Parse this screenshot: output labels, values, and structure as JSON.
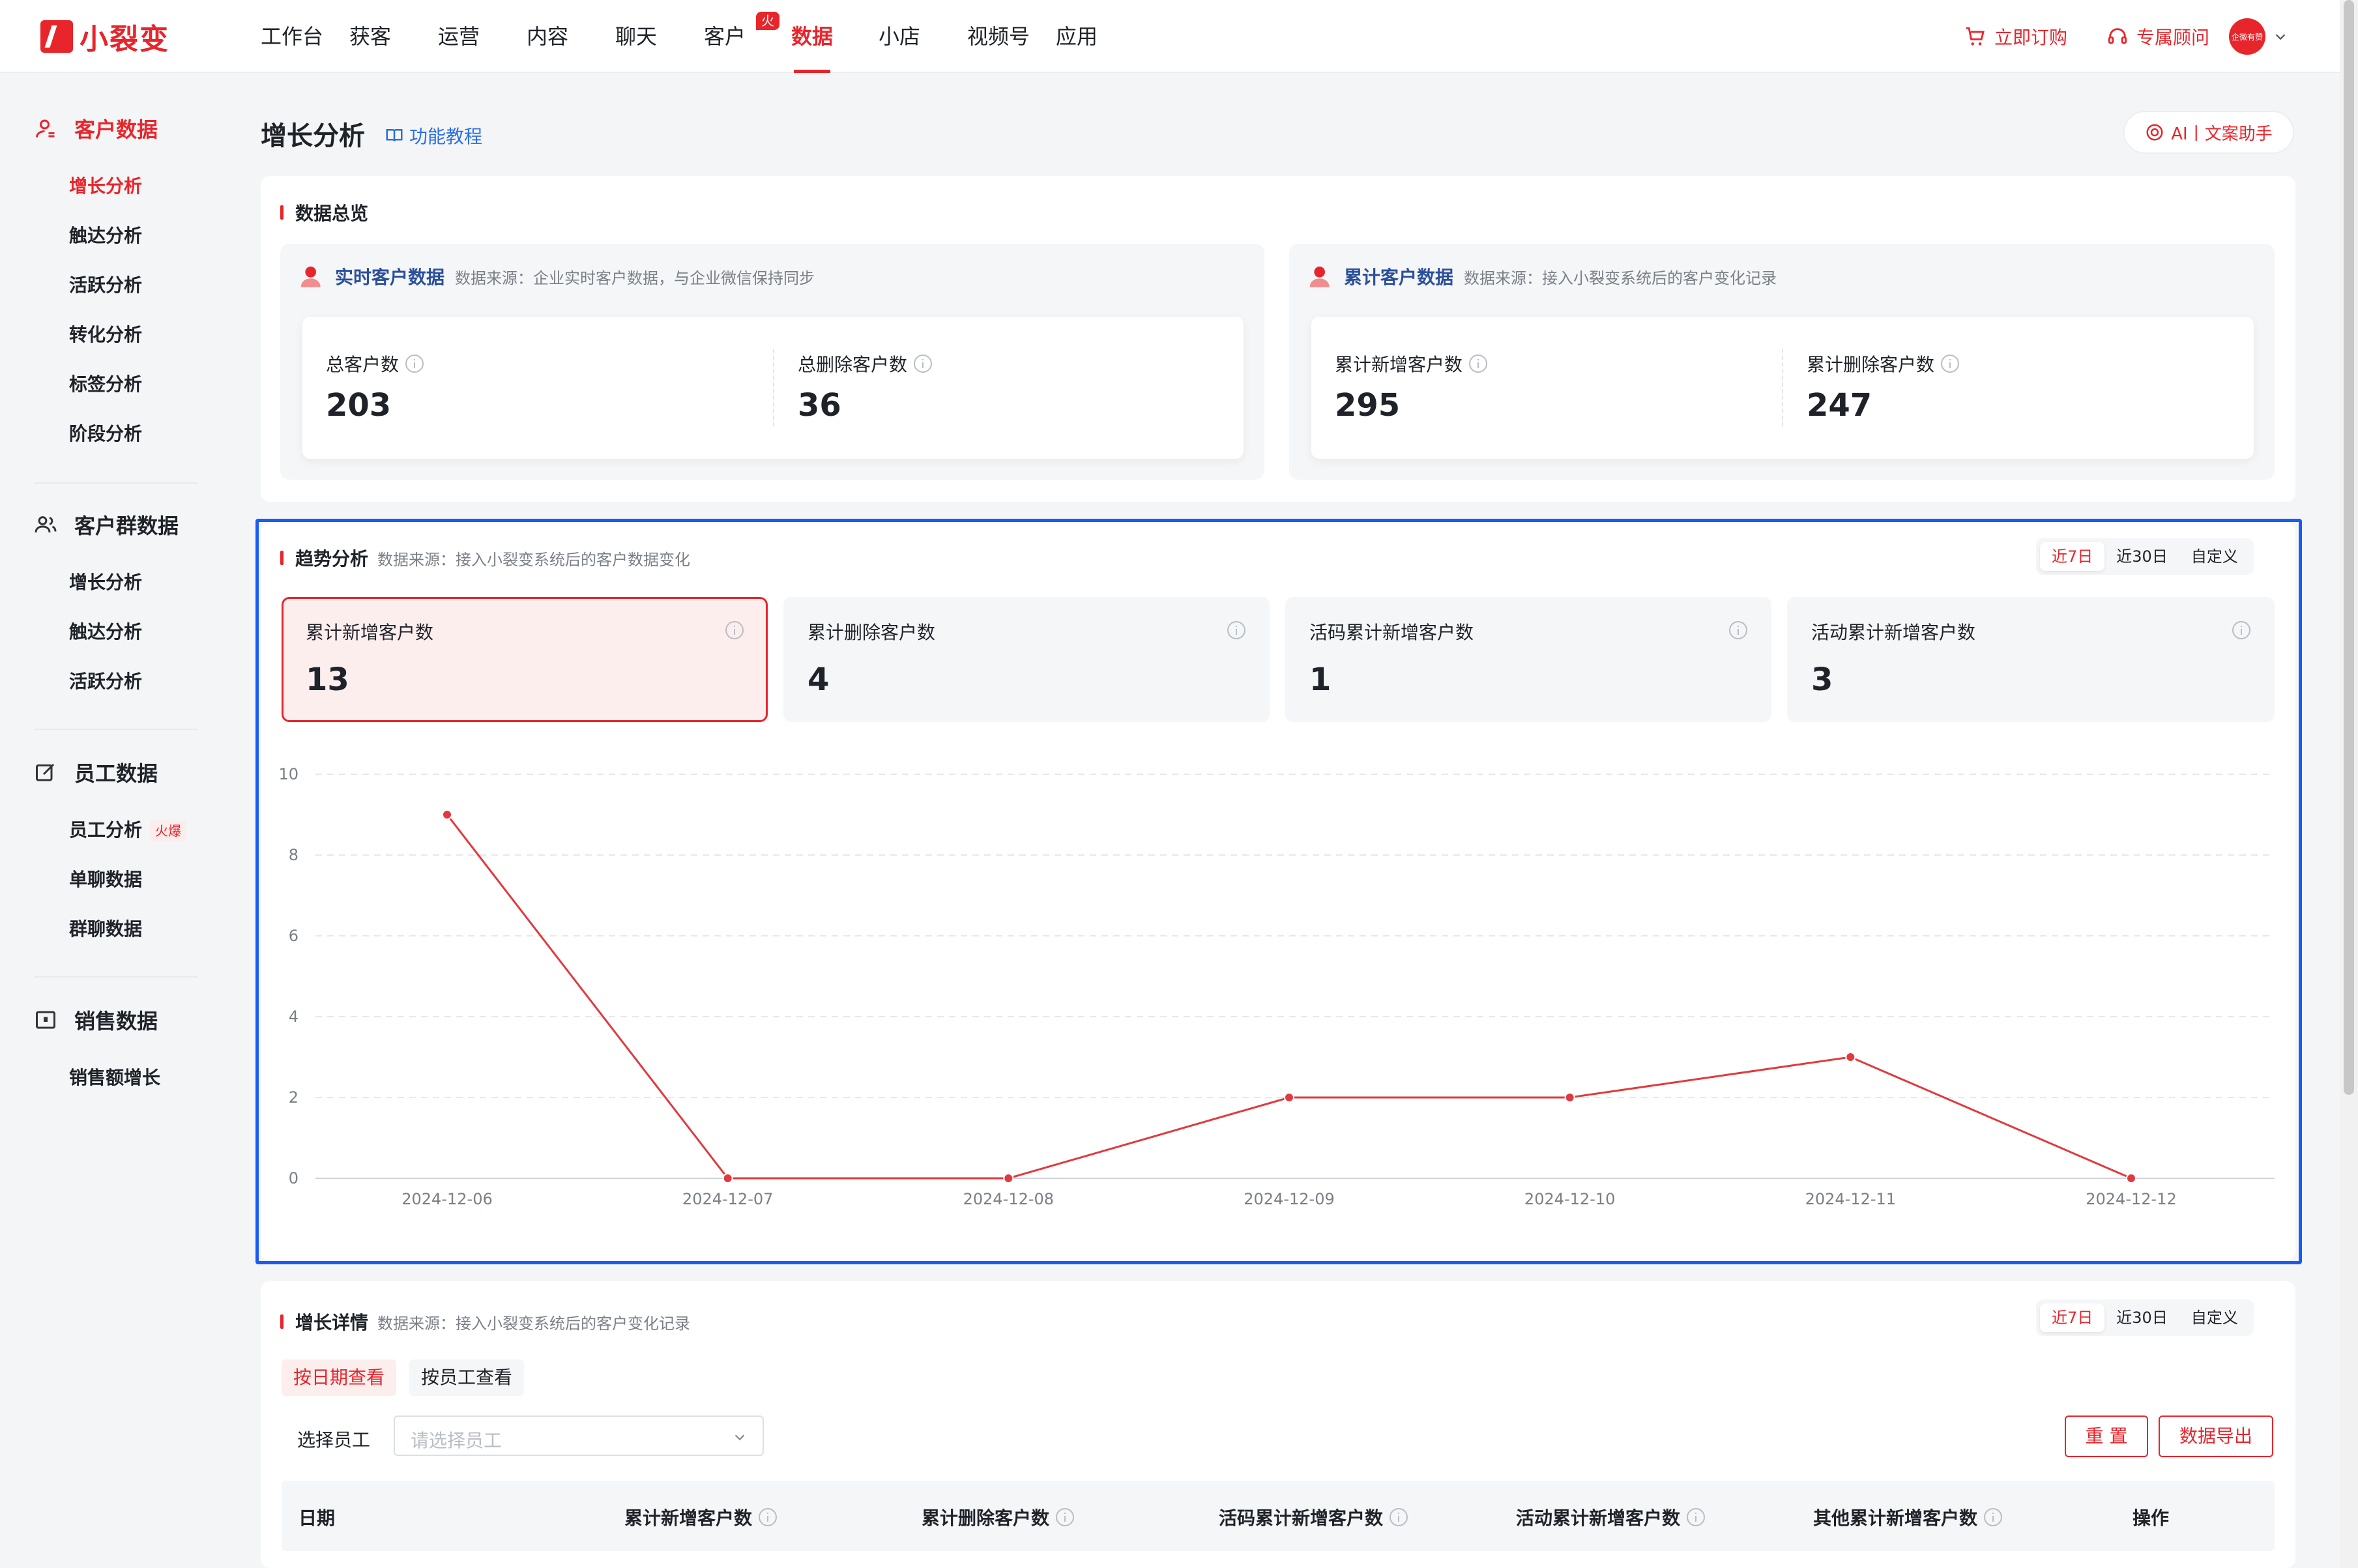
{
  "brand": {
    "name": "小裂变"
  },
  "nav": {
    "items": [
      "工作台",
      "获客",
      "运营",
      "内容",
      "聊天",
      "客户",
      "数据",
      "小店",
      "视频号",
      "应用"
    ],
    "active": "数据",
    "badge": "火爆"
  },
  "top_actions": {
    "order": "立即订购",
    "consultant": "专属顾问",
    "avatar_text": "企微有赞"
  },
  "sidebar": {
    "groups": [
      {
        "title": "客户数据",
        "items": [
          "增长分析",
          "触达分析",
          "活跃分析",
          "转化分析",
          "标签分析",
          "阶段分析"
        ]
      },
      {
        "title": "客户群数据",
        "items": [
          "增长分析",
          "触达分析",
          "活跃分析"
        ]
      },
      {
        "title": "员工数据",
        "items": [
          "员工分析",
          "单聊数据",
          "群聊数据"
        ],
        "hot_badge": "火爆"
      },
      {
        "title": "销售数据",
        "items": [
          "销售额增长"
        ]
      }
    ]
  },
  "page": {
    "title": "增长分析",
    "tutorial": "功能教程",
    "ai_button": "AI丨文案助手"
  },
  "overview": {
    "title": "数据总览",
    "realtime": {
      "title": "实时客户数据",
      "source": "数据来源：企业实时客户数据，与企业微信保持同步",
      "metrics": [
        {
          "label": "总客户数",
          "value": "203"
        },
        {
          "label": "总删除客户数",
          "value": "36"
        }
      ]
    },
    "cumulative": {
      "title": "累计客户数据",
      "source": "数据来源：接入小裂变系统后的客户变化记录",
      "metrics": [
        {
          "label": "累计新增客户数",
          "value": "295"
        },
        {
          "label": "累计删除客户数",
          "value": "247"
        }
      ]
    }
  },
  "trend": {
    "title": "趋势分析",
    "source": "数据来源：接入小裂变系统后的客户数据变化",
    "ranges": [
      "近7日",
      "近30日",
      "自定义"
    ],
    "active_range": "近7日",
    "cards": [
      {
        "label": "累计新增客户数",
        "value": "13"
      },
      {
        "label": "累计删除客户数",
        "value": "4"
      },
      {
        "label": "活码累计新增客户数",
        "value": "1"
      },
      {
        "label": "活动累计新增客户数",
        "value": "3"
      }
    ]
  },
  "chart_data": {
    "type": "line",
    "x": [
      "2024-12-06",
      "2024-12-07",
      "2024-12-08",
      "2024-12-09",
      "2024-12-10",
      "2024-12-11",
      "2024-12-12"
    ],
    "series": [
      {
        "values": [
          9,
          0,
          0,
          2,
          2,
          3,
          0
        ],
        "color": "#e03a3e"
      }
    ],
    "yticks": [
      "0",
      "2",
      "4",
      "6",
      "8",
      "10"
    ],
    "ylim": [
      0,
      10
    ],
    "grid": true
  },
  "details": {
    "title": "增长详情",
    "source": "数据来源：接入小裂变系统后的客户变化记录",
    "ranges": [
      "近7日",
      "近30日",
      "自定义"
    ],
    "active_range": "近7日",
    "tabs": [
      "按日期查看",
      "按员工查看"
    ],
    "filter_label": "选择员工",
    "filter_placeholder": "请选择员工",
    "reset": "重 置",
    "export": "数据导出",
    "columns": [
      "日期",
      "累计新增客户数",
      "累计删除客户数",
      "活码累计新增客户数",
      "活动累计新增客户数",
      "其他累计新增客户数",
      "操作"
    ]
  },
  "colors": {
    "brand": "#e8252b",
    "link": "#2a6fe3",
    "highlight": "#1a5bf5"
  }
}
